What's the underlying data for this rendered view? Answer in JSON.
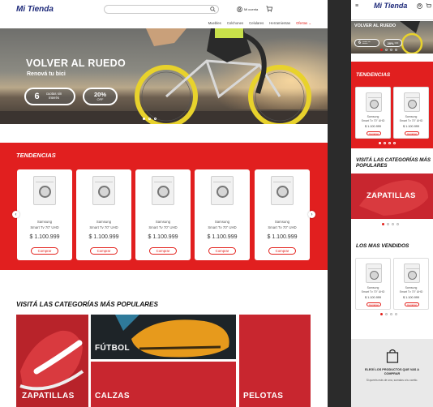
{
  "desktop": {
    "header": {
      "logo": "Mi Tienda",
      "account_label": "Mi cuenta"
    },
    "nav": [
      "Muebles",
      "Colchones",
      "Celulares",
      "Herramientas",
      "Ofertas"
    ],
    "hero": {
      "title": "VOLVER AL RUEDO",
      "subtitle": "Renová tu bici",
      "installments_number": "6",
      "installments_text": "cuotas sin interés",
      "discount_pct": "20%",
      "discount_text": "OFF",
      "slide_count": 3,
      "active_slide": 0
    },
    "trending": {
      "title": "TENDENCIAS",
      "products": [
        {
          "brand": "Samsung",
          "model": "Smart Tv 70\" UHD",
          "price": "$ 1.100.999",
          "buy_label": "Comprar"
        },
        {
          "brand": "Samsung",
          "model": "Smart Tv 70\" UHD",
          "price": "$ 1.100.999",
          "buy_label": "Comprar"
        },
        {
          "brand": "Samsung",
          "model": "Smart Tv 70\" UHD",
          "price": "$ 1.100.999",
          "buy_label": "Comprar"
        },
        {
          "brand": "Samsung",
          "model": "Smart Tv 70\" UHD",
          "price": "$ 1.100.999",
          "buy_label": "Comprar"
        },
        {
          "brand": "Samsung",
          "model": "Smart Tv 70\" UHD",
          "price": "$ 1.100.999",
          "buy_label": "Comprar"
        }
      ]
    },
    "categories": {
      "title": "VISITÁ LAS CATEGORÍAS MÁS POPULARES",
      "items": [
        "ZAPATILLAS",
        "FÚTBOL",
        "CALZAS",
        "PELOTAS"
      ]
    }
  },
  "mobile": {
    "logo": "Mi Tienda",
    "hero": {
      "title": "VOLVER AL RUEDO",
      "installments_number": "6",
      "installments_text": "cuotas sin interés",
      "discount_pct": "20%",
      "discount_text": "OFF"
    },
    "trending": {
      "title": "TENDENCIAS",
      "products": [
        {
          "brand": "Samsung",
          "model": "Smart Tv 70\" UHD",
          "price": "$ 1.100.999",
          "buy_label": "Comprar"
        },
        {
          "brand": "Samsung",
          "model": "Smart Tv 70\" UHD",
          "price": "$ 1.100.999",
          "buy_label": "Comprar"
        }
      ]
    },
    "categories": {
      "title": "VISITÁ LAS CATEGORÍAS MÁS POPULARES",
      "banner_label": "ZAPATILLAS"
    },
    "best_sellers": {
      "title": "LOS MAS VENDIDOS",
      "products": [
        {
          "brand": "Samsung",
          "model": "Smart Tv 70\" UHD",
          "price": "$ 1.100.999",
          "buy_label": "Comprar"
        },
        {
          "brand": "Samsung",
          "model": "Smart Tv 70\" UHD",
          "price": "$ 1.100.999",
          "buy_label": "Comprar"
        }
      ]
    },
    "empty_cart": {
      "title": "ELEGÍ LOS PRODUCTOS QUE VAS A COMPRAR",
      "text": "Si querés más de una, sumalos a tu carrito."
    }
  },
  "colors": {
    "brand_blue": "#1e2a7a",
    "accent_red": "#e11f1f",
    "category_red": "#c8262f"
  }
}
